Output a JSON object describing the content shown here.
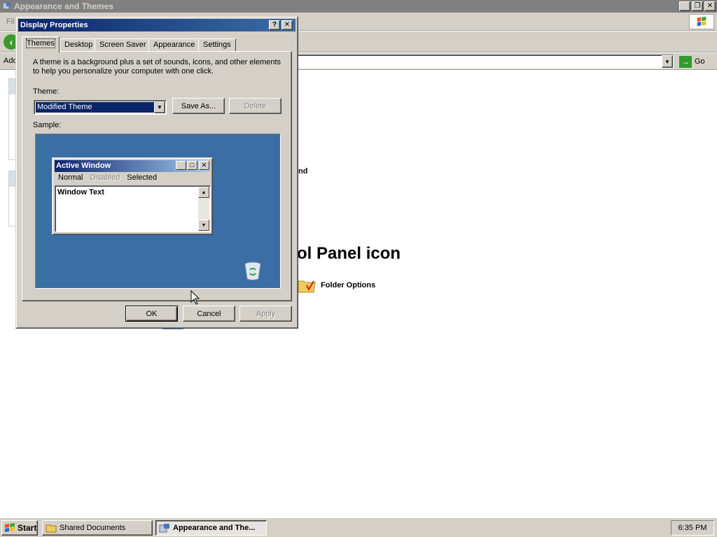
{
  "explorer": {
    "title": "Appearance and Themes",
    "menu_fragment": "Fil",
    "address_fragment": "Add",
    "go_label": "Go",
    "content_fragment_nd": "nd",
    "content_heading_fragment": "ol Panel icon",
    "folder_options_label": "Folder Options"
  },
  "dialog": {
    "title": "Display Properties",
    "help_glyph": "?",
    "close_glyph": "✕",
    "tabs": [
      {
        "label": "Themes",
        "active": true
      },
      {
        "label": "Desktop",
        "active": false
      },
      {
        "label": "Screen Saver",
        "active": false
      },
      {
        "label": "Appearance",
        "active": false
      },
      {
        "label": "Settings",
        "active": false
      }
    ],
    "description": "A theme is a background plus a set of sounds, icons, and other elements to help you personalize your computer with one click.",
    "theme_label": "Theme:",
    "theme_value": "Modified Theme",
    "save_as_label": "Save As...",
    "delete_label": "Delete",
    "sample_label": "Sample:",
    "ok_label": "OK",
    "cancel_label": "Cancel",
    "apply_label": "Apply"
  },
  "sample_window": {
    "title": "Active Window",
    "menu_normal": "Normal",
    "menu_disabled": "Disabled",
    "menu_selected": "Selected",
    "body_text": "Window Text"
  },
  "taskbar": {
    "start_label": "Start",
    "items": [
      {
        "label": "Shared Documents",
        "active": false
      },
      {
        "label": "Appearance and The...",
        "active": true
      }
    ],
    "clock": "6:35 PM"
  },
  "colors": {
    "title_active_start": "#0a246a",
    "title_active_end": "#3a6ea5",
    "desktop_blue": "#3a6ea5",
    "face": "#d4d0c8"
  }
}
